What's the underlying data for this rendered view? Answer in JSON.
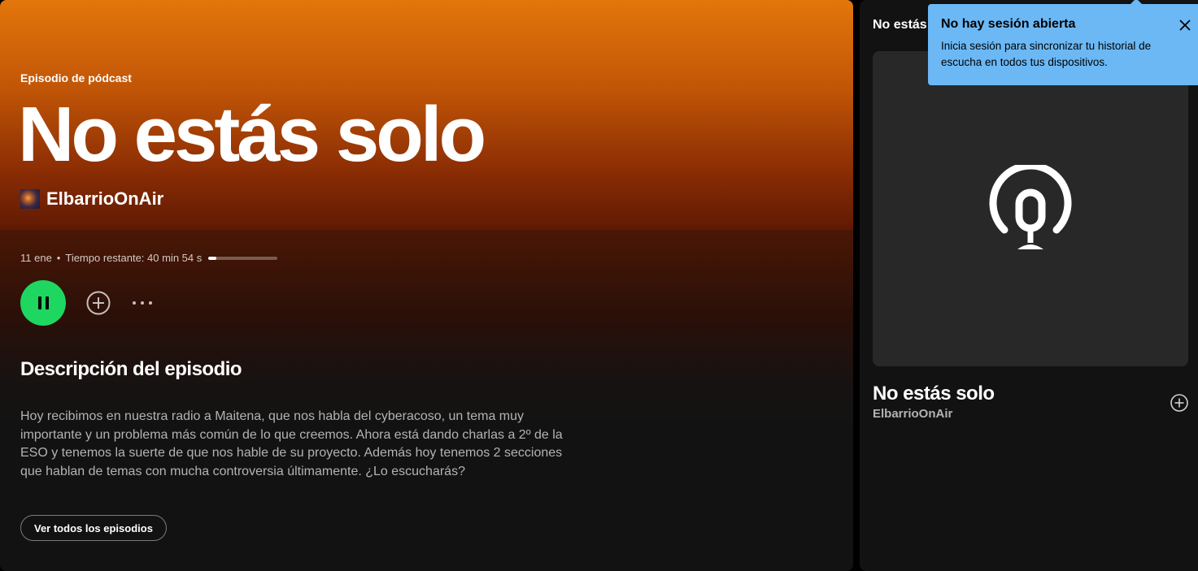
{
  "episode": {
    "kind_label": "Episodio de pódcast",
    "title": "No estás solo",
    "show_name": "ElbarrioOnAir",
    "date": "11 ene",
    "separator": "•",
    "time_left": "Tiempo restante: 40 min 54 s",
    "progress_fraction": 0.12
  },
  "description": {
    "heading": "Descripción del episodio",
    "text": "Hoy recibimos en nuestra radio a Maitena, que nos habla del cyberacoso, un tema muy importante y un problema más común de lo que creemos. Ahora está dando charlas a 2º de la ESO y tenemos la suerte de que nos hable de su proyecto. Además hoy tenemos 2 secciones que hablan de temas con mucha controversia últimamente. ¿Lo escucharás?",
    "all_episodes_label": "Ver todos los episodios"
  },
  "controls": {
    "play_state": "pause-icon",
    "add_icon": "add-circle-icon",
    "more_icon": "more-options-icon"
  },
  "side_panel": {
    "header": "No estás s",
    "art_icon": "podcast-icon",
    "title": "No estás solo",
    "show": "ElbarrioOnAir"
  },
  "toast": {
    "title": "No hay sesión abierta",
    "body": "Inicia sesión para sincronizar tu historial de escucha en todos tus dispositivos."
  },
  "colors": {
    "accent_green": "#1ed760",
    "hero_orange": "#e3760b",
    "toast_blue": "#6bb8f5",
    "background": "#121212"
  }
}
